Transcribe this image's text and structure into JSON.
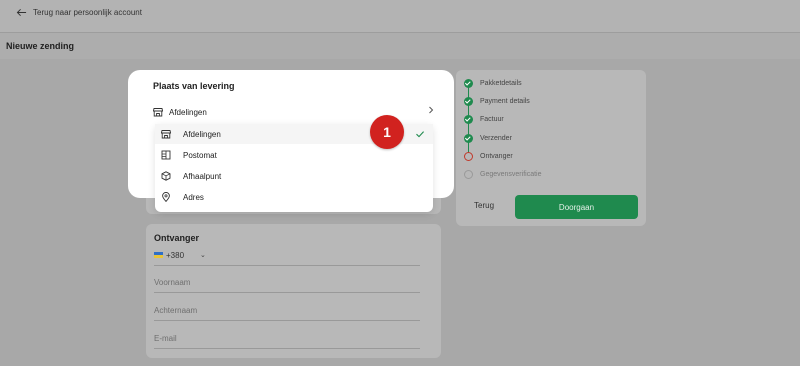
{
  "header": {
    "back_label": "Terug naar persoonlijk account"
  },
  "page": {
    "title": "Nieuwe zending"
  },
  "delivery_popup": {
    "title": "Plaats van levering",
    "selected_label": "Afdelingen",
    "options": [
      {
        "label": "Afdelingen",
        "icon": "store-icon",
        "selected": true
      },
      {
        "label": "Postomat",
        "icon": "locker-icon",
        "selected": false
      },
      {
        "label": "Afhaalpunt",
        "icon": "box-icon",
        "selected": false
      },
      {
        "label": "Adres",
        "icon": "location-pin-icon",
        "selected": false
      }
    ]
  },
  "annotation_badge": "1",
  "recipient": {
    "title": "Ontvanger",
    "phone_code": "+380",
    "first_name_placeholder": "Voornaam",
    "last_name_placeholder": "Achternaam",
    "email_placeholder": "E-mail"
  },
  "steps": [
    {
      "label": "Pakketdetails",
      "status": "done"
    },
    {
      "label": "Payment details",
      "status": "done"
    },
    {
      "label": "Factuur",
      "status": "done"
    },
    {
      "label": "Verzender",
      "status": "done"
    },
    {
      "label": "Ontvanger",
      "status": "current"
    },
    {
      "label": "Gegevensverificatie",
      "status": "todo"
    }
  ],
  "actions": {
    "back_label": "Terug",
    "next_label": "Doorgaan"
  },
  "colors": {
    "accent": "#1f8a4e",
    "badge": "#d1221f",
    "current_step": "#c0392b"
  }
}
